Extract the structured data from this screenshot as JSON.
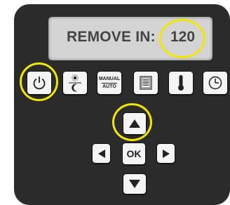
{
  "display": {
    "label": "REMOVE IN:",
    "value": "120"
  },
  "function_row": {
    "power": {
      "icon": "power-icon"
    },
    "day_night": {
      "icon": "sun-moon-icon"
    },
    "mode": {
      "icon": "manual-auto-icon",
      "top": "MANUAL",
      "bottom": "AUTO"
    },
    "program": {
      "icon": "document-icon"
    },
    "temperature": {
      "icon": "thermometer-icon"
    },
    "clock": {
      "icon": "clock-icon"
    }
  },
  "navigation": {
    "up": {
      "icon": "arrow-up-icon"
    },
    "left": {
      "icon": "arrow-left-icon"
    },
    "ok": {
      "label": "OK"
    },
    "right": {
      "icon": "arrow-right-icon"
    },
    "down": {
      "icon": "arrow-down-icon"
    }
  },
  "highlight_color": "#f2e600",
  "panel_color": "#2b2b2b"
}
